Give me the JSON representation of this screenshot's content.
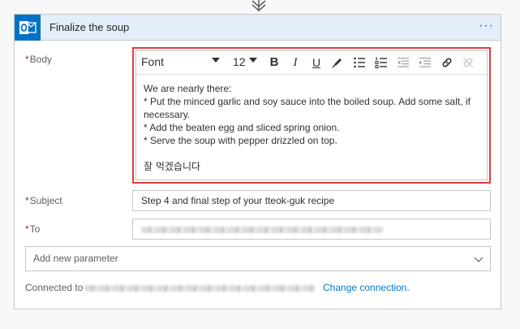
{
  "card": {
    "title": "Finalize the soup",
    "more_label": "···"
  },
  "fields": {
    "body": {
      "label": "Body",
      "toolbar": {
        "font": "Font",
        "size": "12",
        "bold": "B",
        "italic": "I",
        "underline": "U"
      },
      "lines": [
        "We are nearly there:",
        "* Put the minced garlic and soy sauce into the boiled soup. Add some salt, if necessary.",
        "* Add the beaten egg and sliced spring onion.",
        "* Serve the soup with pepper drizzled on top."
      ],
      "signoff": "잘 먹겠습니다"
    },
    "subject": {
      "label": "Subject",
      "value": "Step 4 and final step of your tteok-guk recipe"
    },
    "to": {
      "label": "To"
    }
  },
  "add_parameter": {
    "placeholder": "Add new parameter"
  },
  "connection": {
    "prefix": "Connected to",
    "change_link": "Change connection."
  },
  "colors": {
    "accent": "#0078d4",
    "header_bg": "#e3eefa",
    "outlook_blue": "#0072c6",
    "highlight_border": "#e23d3d",
    "required": "#a4262c"
  }
}
